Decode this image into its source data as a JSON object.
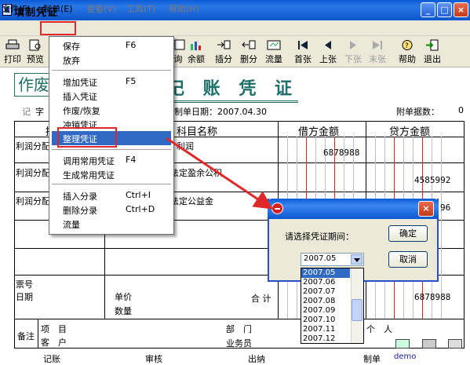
{
  "window": {
    "title": "填制凭证",
    "minimize": "_",
    "maximize": "□",
    "close": "×"
  },
  "menubar": {
    "items": [
      {
        "label": "文件(F)",
        "enabled": true
      },
      {
        "label": "制单(E)",
        "enabled": true
      },
      {
        "label": "查看(V)",
        "enabled": false
      },
      {
        "label": "工具(T)",
        "enabled": false
      },
      {
        "label": "帮助(H)",
        "enabled": false
      }
    ]
  },
  "toolbar": {
    "print": "打印",
    "preview": "预览",
    "query_partial": "询",
    "balance": "余额",
    "insert": "插分",
    "delete": "删分",
    "flow": "流量",
    "first": "首张",
    "prev": "上张",
    "next": "下张",
    "last": "末张",
    "help": "帮助",
    "exit": "退出"
  },
  "dropdown": {
    "items": [
      {
        "label": "保存",
        "shortcut": "F6"
      },
      {
        "label": "放弃",
        "shortcut": ""
      },
      {
        "label": "增加凭证",
        "shortcut": "F5"
      },
      {
        "label": "插入凭证",
        "shortcut": ""
      },
      {
        "label": "作废/恢复",
        "shortcut": ""
      },
      {
        "label": "冲销凭证",
        "shortcut": ""
      },
      {
        "label": "整理凭证",
        "shortcut": ""
      },
      {
        "label": "调用常用凭证",
        "shortcut": "F4"
      },
      {
        "label": "生成常用凭证",
        "shortcut": ""
      },
      {
        "label": "插入分录",
        "shortcut": "Ctrl+I"
      },
      {
        "label": "删除分录",
        "shortcut": "Ctrl+D"
      },
      {
        "label": "流量",
        "shortcut": ""
      }
    ],
    "highlighted": "整理凭证"
  },
  "voucher": {
    "big_left": "作废",
    "title": "记 账 凭 证",
    "type_prefix": "记",
    "type_value": "字",
    "date_label": "制单日期：2007.04.30",
    "attach_label": "附单据数：",
    "attach_value": "0",
    "col_summary": "摘",
    "col_subject": "科目名称",
    "col_debit": "借方金额",
    "col_credit": "贷方金额",
    "rows": [
      {
        "summary": "利润分配",
        "subject": "利润",
        "debit": "6878988",
        "credit": ""
      },
      {
        "summary": "利润分配",
        "subject": "法定盈余公积",
        "debit": "",
        "credit": "4585992"
      },
      {
        "summary": "利润分配",
        "subject": "法定公益金",
        "debit": "",
        "credit": "96"
      }
    ],
    "ticket_no": "票号",
    "date": "日期",
    "unit_price": "单价",
    "quantity": "数量",
    "total": "合 计",
    "total_debit": "6878988",
    "remark": "备注",
    "project": "项　目",
    "customer": "客　户",
    "department": "部　门",
    "salesperson": "业务员",
    "personal": "个　人",
    "bookkeeper": "记账",
    "auditor": "审核",
    "cashier": "出纳",
    "maker": "制单",
    "maker_value": "demo"
  },
  "dialog": {
    "prompt": "请选择凭证期间：",
    "ok": "确定",
    "cancel": "取消",
    "selected": "2007.05",
    "options": [
      "2007.05",
      "2007.06",
      "2007.07",
      "2007.08",
      "2007.09",
      "2007.10",
      "2007.11",
      "2007.12"
    ]
  },
  "colors": {
    "title_bar": "#0a5bd6",
    "teal": "#1e6e6a",
    "highlight": "#316ac5",
    "annotation": "#e0282a"
  }
}
